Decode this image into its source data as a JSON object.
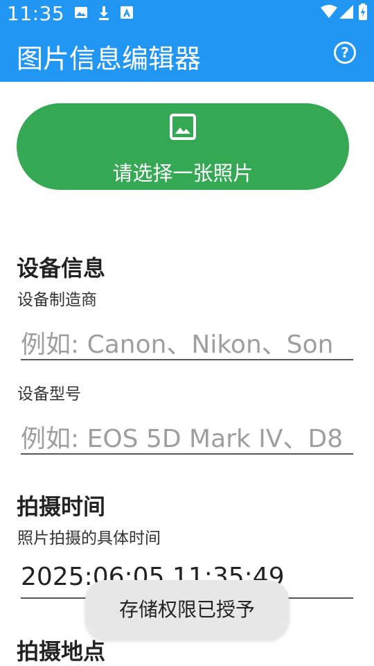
{
  "status_bar": {
    "time": "11:35",
    "icons": [
      "gallery-icon",
      "download-icon",
      "accessibility-icon",
      "wifi-icon",
      "signal-icon",
      "battery-charging-icon"
    ]
  },
  "app_bar": {
    "title": "图片信息编辑器",
    "help_icon": "help-circle-icon",
    "help_glyph": "?"
  },
  "pick_button": {
    "icon": "image-icon",
    "label": "请选择一张照片"
  },
  "device_section": {
    "title": "设备信息",
    "manufacturer_label": "设备制造商",
    "manufacturer_placeholder": "例如: Canon、Nikon、Son",
    "model_label": "设备型号",
    "model_placeholder": "例如: EOS 5D Mark IV、D8"
  },
  "time_section": {
    "title": "拍摄时间",
    "label": "照片拍摄的具体时间",
    "value": "2025:06:05 11:35:49"
  },
  "location_section": {
    "title": "拍摄地点"
  },
  "toast": {
    "text": "存储权限已授予"
  },
  "colors": {
    "primary": "#2196f3",
    "button_green": "#34a853"
  }
}
